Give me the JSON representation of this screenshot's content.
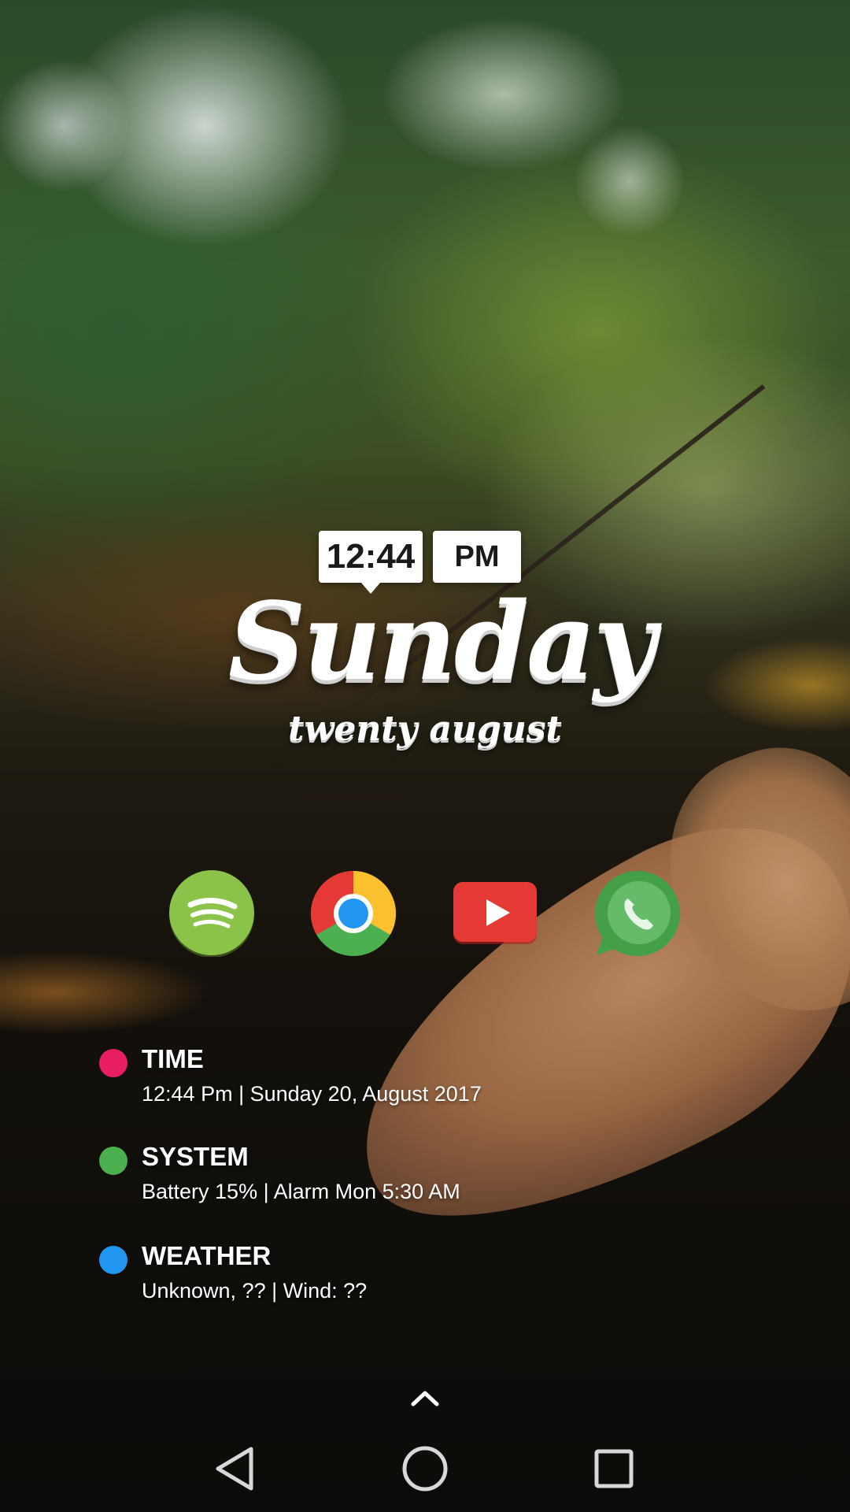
{
  "clock": {
    "time": "12:44",
    "ampm": "PM",
    "day": "Sunday",
    "date_words": "twenty august"
  },
  "dock": [
    {
      "name": "Spotify",
      "icon": "spotify-icon",
      "color": "#7cb342"
    },
    {
      "name": "Chrome",
      "icon": "chrome-icon",
      "color": "#4285f4"
    },
    {
      "name": "YouTube",
      "icon": "youtube-icon",
      "color": "#e53935"
    },
    {
      "name": "Phone",
      "icon": "phone-icon",
      "color": "#4caf50"
    }
  ],
  "info": {
    "time": {
      "title": "TIME",
      "detail": "12:44 Pm  |  Sunday 20, August 2017",
      "dot_color": "#e91e63"
    },
    "system": {
      "title": "SYSTEM",
      "detail": "Battery 15%  |  Alarm Mon 5:30 AM",
      "dot_color": "#4caf50"
    },
    "weather": {
      "title": "WEATHER",
      "detail": "Unknown, ??  |  Wind: ??",
      "dot_color": "#2196f3"
    }
  },
  "nav": {
    "drawer": "chevron-up-icon",
    "back": "back-triangle-icon",
    "home": "home-circle-icon",
    "recents": "recents-square-icon"
  }
}
